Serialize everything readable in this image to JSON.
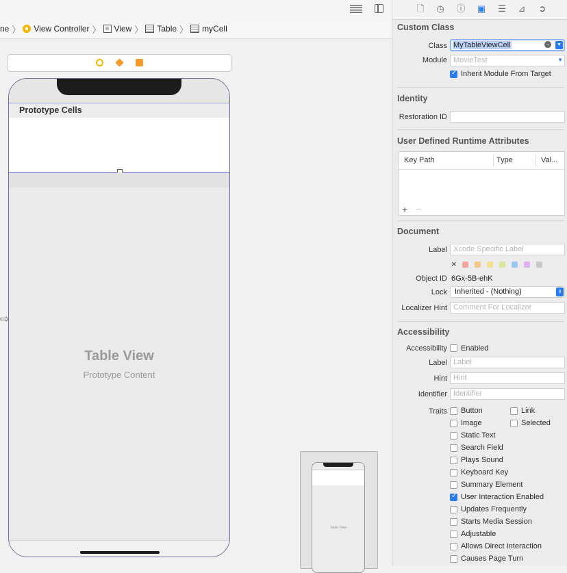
{
  "breadcrumb": {
    "items": [
      {
        "label": "ne",
        "icon": "none"
      },
      {
        "label": "View Controller",
        "icon": "view-controller-icon"
      },
      {
        "label": "View",
        "icon": "view-icon"
      },
      {
        "label": "Table",
        "icon": "table-icon"
      },
      {
        "label": "myCell",
        "icon": "table-cell-icon"
      }
    ]
  },
  "canvas": {
    "prototype_cells_label": "Prototype Cells",
    "table_view_title": "Table View",
    "table_view_subtitle": "Prototype Content",
    "mini_table_text": "Table View"
  },
  "inspector": {
    "custom_class": {
      "header": "Custom Class",
      "class_label": "Class",
      "class_value": "MyTableViewCell",
      "module_label": "Module",
      "module_placeholder": "MovieTest",
      "inherit_label": "Inherit Module From Target",
      "inherit_checked": true
    },
    "identity": {
      "header": "Identity",
      "restoration_label": "Restoration ID",
      "restoration_value": ""
    },
    "runtime": {
      "header": "User Defined Runtime Attributes",
      "col_keypath": "Key Path",
      "col_type": "Type",
      "col_value": "Val...",
      "add": "+",
      "remove": "−"
    },
    "document": {
      "header": "Document",
      "label_label": "Label",
      "label_placeholder": "Xcode Specific Label",
      "clear": "×",
      "swatch_colors": [
        "#f3a7a0",
        "#f6c78a",
        "#f3e08d",
        "#d7e89a",
        "#9ec8f2",
        "#dcb3ec",
        "#c8c8c8"
      ],
      "object_id_label": "Object ID",
      "object_id_value": "6Gx-5B-ehK",
      "lock_label": "Lock",
      "lock_value": "Inherited - (Nothing)",
      "localizer_label": "Localizer Hint",
      "localizer_placeholder": "Comment For Localizer"
    },
    "accessibility": {
      "header": "Accessibility",
      "accessibility_label": "Accessibility",
      "enabled_label": "Enabled",
      "label_label": "Label",
      "label_placeholder": "Label",
      "hint_label": "Hint",
      "hint_placeholder": "Hint",
      "identifier_label": "Identifier",
      "identifier_placeholder": "Identifier",
      "traits_label": "Traits",
      "traits": [
        {
          "label": "Button",
          "checked": false
        },
        {
          "label": "Link",
          "checked": false
        },
        {
          "label": "Image",
          "checked": false
        },
        {
          "label": "Selected",
          "checked": false
        },
        {
          "label": "Static Text",
          "checked": false
        },
        {
          "label": "Search Field",
          "checked": false
        },
        {
          "label": "Plays Sound",
          "checked": false
        },
        {
          "label": "Keyboard Key",
          "checked": false
        },
        {
          "label": "Summary Element",
          "checked": false
        },
        {
          "label": "User Interaction Enabled",
          "checked": true
        },
        {
          "label": "Updates Frequently",
          "checked": false
        },
        {
          "label": "Starts Media Session",
          "checked": false
        },
        {
          "label": "Adjustable",
          "checked": false
        },
        {
          "label": "Allows Direct Interaction",
          "checked": false
        },
        {
          "label": "Causes Page Turn",
          "checked": false
        }
      ]
    }
  },
  "colors": {
    "accent": "#2a7af1",
    "selection_border": "#6b6bd6",
    "scene_dock_yellow": "#f6b700",
    "scene_dock_orange": "#f59b2b"
  }
}
